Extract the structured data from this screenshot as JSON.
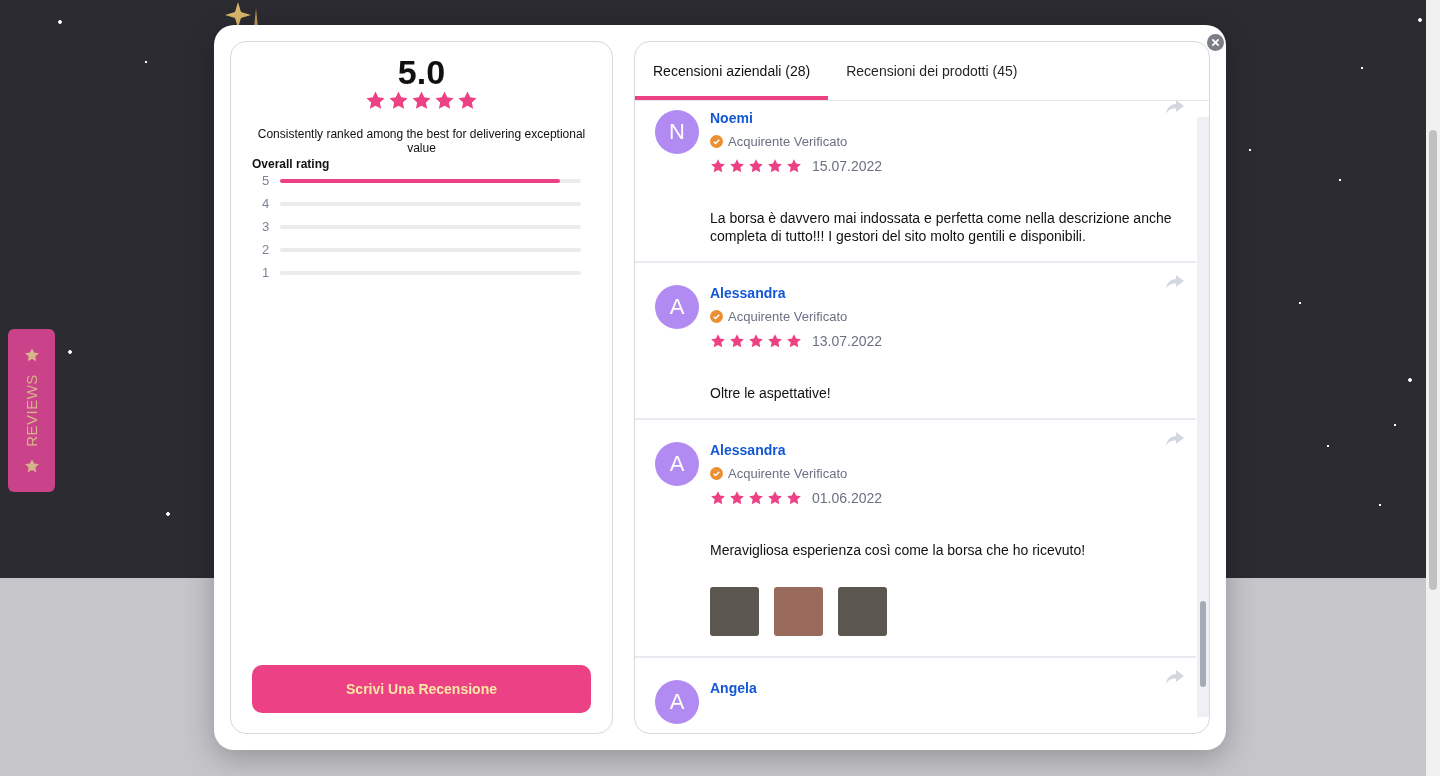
{
  "reviews_tab": {
    "label": "REVIEWS"
  },
  "summary": {
    "score": "5.0",
    "stars": 5,
    "tagline": "Consistently ranked among the best for delivering exceptional value",
    "overall_label": "Overall rating",
    "distribution": [
      {
        "label": "5",
        "level": 0.93
      },
      {
        "label": "4"
      },
      {
        "label": "3"
      },
      {
        "label": "2"
      },
      {
        "label": "1"
      }
    ],
    "write_button": "Scrivi Una Recensione"
  },
  "tabs": [
    {
      "label": "Recensioni aziendali (28)",
      "selected": true
    },
    {
      "label": "Recensioni dei prodotti (45)",
      "selected": false
    }
  ],
  "reviews": [
    {
      "initial": "N",
      "name": "Noemi",
      "badge": "Acquirente Verificato",
      "stars": 5,
      "date": "15.07.2022",
      "text": "La borsa è davvero mai indossata e perfetta come nella descrizione anche completa di tutto!!! I gestori del sito molto gentili e disponibili."
    },
    {
      "initial": "A",
      "name": "Alessandra",
      "badge": "Acquirente Verificato",
      "stars": 5,
      "date": "13.07.2022",
      "text": "Oltre le aspettative!"
    },
    {
      "initial": "A",
      "name": "Alessandra",
      "badge": "Acquirente Verificato",
      "stars": 5,
      "date": "01.06.2022",
      "text": "Meravigliosa esperienza così come la borsa che ho ricevuto!",
      "photos": [
        {
          "kind": "photo"
        },
        {
          "kind": "photo"
        },
        {
          "kind": "photo"
        }
      ]
    },
    {
      "initial": "A",
      "name": "Angela"
    }
  ]
}
